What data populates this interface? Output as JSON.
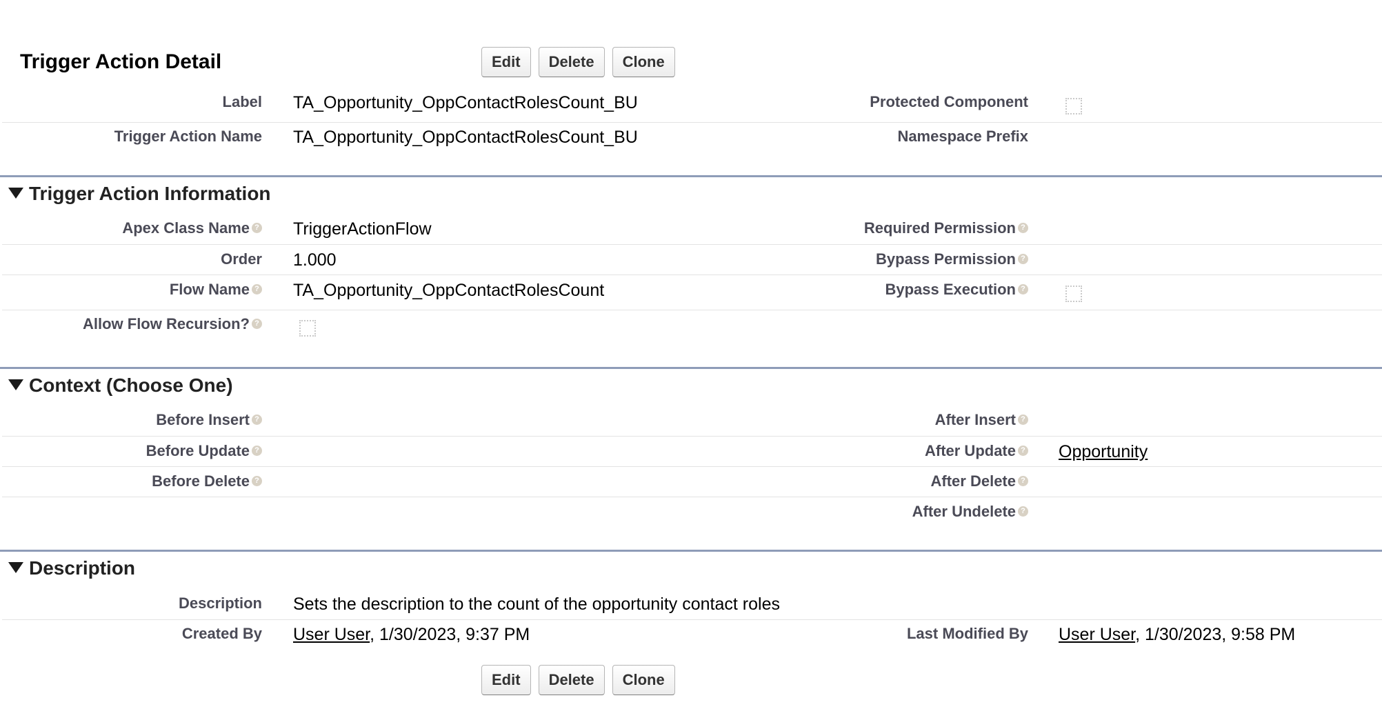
{
  "page": {
    "title": "Trigger Action Detail"
  },
  "buttons": {
    "edit": "Edit",
    "delete": "Delete",
    "clone": "Clone"
  },
  "header_fields": {
    "label": {
      "label": "Label",
      "value": "TA_Opportunity_OppContactRolesCount_BU"
    },
    "protected_component": {
      "label": "Protected Component",
      "checked": false
    },
    "trigger_action_name": {
      "label": "Trigger Action Name",
      "value": "TA_Opportunity_OppContactRolesCount_BU"
    },
    "namespace_prefix": {
      "label": "Namespace Prefix",
      "value": ""
    }
  },
  "trigger_action_information": {
    "heading": "Trigger Action Information",
    "apex_class_name": {
      "label": "Apex Class Name",
      "value": "TriggerActionFlow"
    },
    "required_permission": {
      "label": "Required Permission",
      "value": ""
    },
    "order": {
      "label": "Order",
      "value": "1.000"
    },
    "bypass_permission": {
      "label": "Bypass Permission",
      "value": ""
    },
    "flow_name": {
      "label": "Flow Name",
      "value": "TA_Opportunity_OppContactRolesCount"
    },
    "bypass_execution": {
      "label": "Bypass Execution",
      "checked": false
    },
    "allow_flow_recursion": {
      "label": "Allow Flow Recursion?",
      "checked": false
    }
  },
  "context": {
    "heading": "Context (Choose One)",
    "before_insert": {
      "label": "Before Insert",
      "value": ""
    },
    "after_insert": {
      "label": "After Insert",
      "value": ""
    },
    "before_update": {
      "label": "Before Update",
      "value": ""
    },
    "after_update": {
      "label": "After Update",
      "value": "Opportunity"
    },
    "before_delete": {
      "label": "Before Delete",
      "value": ""
    },
    "after_delete": {
      "label": "After Delete",
      "value": ""
    },
    "after_undelete": {
      "label": "After Undelete",
      "value": ""
    }
  },
  "description_section": {
    "heading": "Description",
    "description": {
      "label": "Description",
      "value": "Sets the description to the count of the opportunity contact roles"
    },
    "created_by": {
      "label": "Created By",
      "user": "User User",
      "date": ", 1/30/2023, 9:37 PM"
    },
    "last_modified_by": {
      "label": "Last Modified By",
      "user": "User User",
      "date": ", 1/30/2023, 9:58 PM"
    }
  },
  "icons": {
    "help": "help-icon",
    "collapse": "triangle-down-icon"
  },
  "colors": {
    "section_rule": "#8e9cb8",
    "label_text": "#4a4a56",
    "help_icon": "#d8d1c4"
  }
}
